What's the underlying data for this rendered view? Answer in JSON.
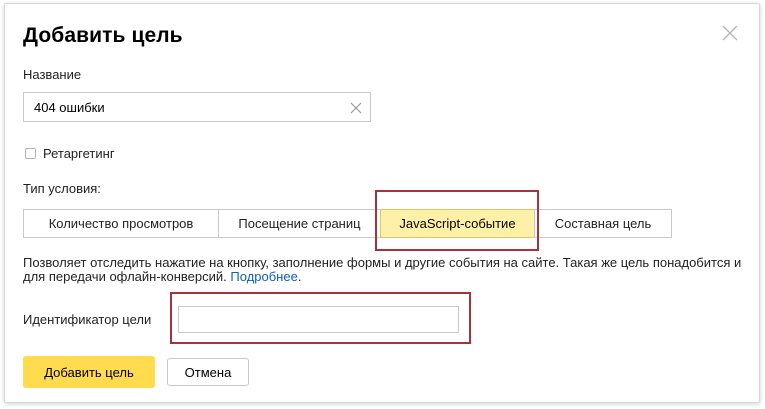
{
  "dialog": {
    "title": "Добавить цель",
    "close_icon": "close-icon"
  },
  "name_field": {
    "label": "Название",
    "value": "404 ошибки",
    "clear_icon": "clear-icon"
  },
  "retargeting": {
    "label": "Ретаргетинг",
    "checked": false
  },
  "condition_type": {
    "label": "Тип условия:",
    "tabs": [
      {
        "label": "Количество просмотров",
        "active": false
      },
      {
        "label": "Посещение страниц",
        "active": false
      },
      {
        "label": "JavaScript-событие",
        "active": true
      },
      {
        "label": "Составная цель",
        "active": false
      }
    ]
  },
  "description": {
    "text": "Позволяет отследить нажатие на кнопку, заполнение формы и другие события на сайте. Такая же цель понадобится и для передачи офлайн-конверсий.",
    "link": "Подробнее"
  },
  "goal_id": {
    "label": "Идентификатор цели",
    "value": ""
  },
  "actions": {
    "submit_label": "Добавить цель",
    "cancel_label": "Отмена"
  },
  "colors": {
    "accent": "#ffdb4d",
    "active_tab": "#fff0a8",
    "link": "#0c5fc7",
    "highlight_box": "#a8323b"
  }
}
